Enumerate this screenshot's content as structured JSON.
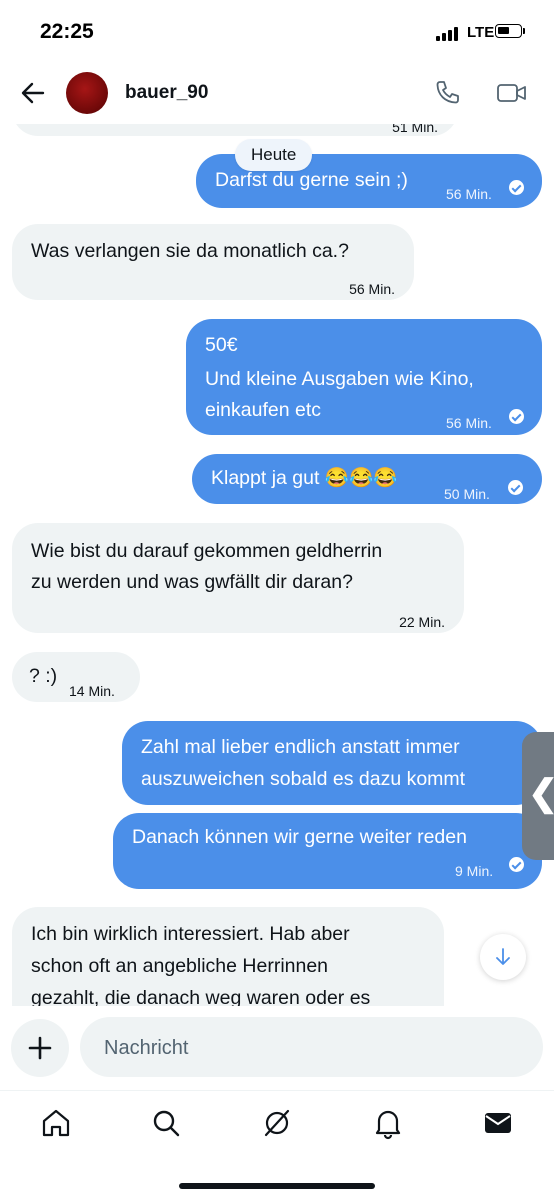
{
  "status_bar": {
    "time": "22:25",
    "network": "LTE"
  },
  "header": {
    "username": "bauer_90"
  },
  "chat": {
    "date_divider": "Heute",
    "partial_top_time": "51 Min.",
    "messages": [
      {
        "dir": "out",
        "lines": [
          "Darfst du gerne sein ;)"
        ],
        "time": "56 Min.",
        "read": true
      },
      {
        "dir": "in",
        "lines": [
          "Was verlangen sie da monatlich ca.?"
        ],
        "time": "56 Min."
      },
      {
        "dir": "out",
        "lines": [
          "50€",
          "Und kleine Ausgaben wie Kino,",
          "einkaufen etc"
        ],
        "time": "56 Min.",
        "read": true
      },
      {
        "dir": "out",
        "lines": [
          "Klappt ja gut 😂😂😂"
        ],
        "time": "50 Min.",
        "read": true
      },
      {
        "dir": "in",
        "lines": [
          "Wie bist du darauf gekommen geldherrin",
          "zu werden und was gwfällt dir daran?"
        ],
        "time": "22 Min."
      },
      {
        "dir": "in",
        "lines": [
          "? :)"
        ],
        "time": "14 Min."
      },
      {
        "dir": "out",
        "lines": [
          "Zahl mal lieber endlich anstatt immer",
          "auszuweichen sobald es dazu kommt"
        ]
      },
      {
        "dir": "out",
        "lines": [
          "Danach können wir gerne weiter reden"
        ],
        "time": "9 Min.",
        "read": true
      },
      {
        "dir": "in",
        "lines": [
          "Ich bin wirklich interessiert. Hab aber",
          "schon oft an angebliche Herrinnen",
          "gezahlt, die danach weg waren oder es"
        ]
      }
    ]
  },
  "composer": {
    "placeholder": "Nachricht"
  },
  "bottom_nav": [
    "home-icon",
    "search-icon",
    "grok-icon",
    "notifications-icon",
    "messages-icon"
  ],
  "colors": {
    "outgoing": "#4b8fe9",
    "incoming": "#eff3f4",
    "text": "#0f1419"
  }
}
